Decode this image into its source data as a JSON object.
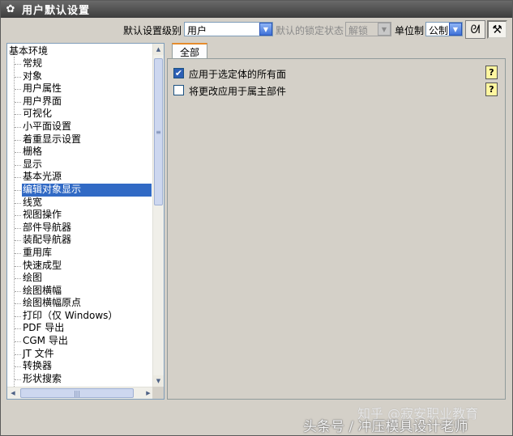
{
  "window": {
    "title": "用户默认设置",
    "icon": "gear-icon"
  },
  "toolbar": {
    "level_label": "默认设置级别",
    "level_value": "用户",
    "lock_label": "默认的锁定状态",
    "lock_value": "解锁",
    "unit_label": "单位制",
    "unit_value": "公制"
  },
  "tree": {
    "root": "基本环境",
    "items": [
      {
        "label": "常规"
      },
      {
        "label": "对象"
      },
      {
        "label": "用户属性"
      },
      {
        "label": "用户界面"
      },
      {
        "label": "可视化"
      },
      {
        "label": "小平面设置"
      },
      {
        "label": "着重显示设置"
      },
      {
        "label": "栅格"
      },
      {
        "label": "显示"
      },
      {
        "label": "基本光源"
      },
      {
        "label": "编辑对象显示"
      },
      {
        "label": "线宽"
      },
      {
        "label": "视图操作"
      },
      {
        "label": "部件导航器"
      },
      {
        "label": "装配导航器"
      },
      {
        "label": "重用库"
      },
      {
        "label": "快速成型"
      },
      {
        "label": "绘图"
      },
      {
        "label": "绘图横幅"
      },
      {
        "label": "绘图横幅原点"
      },
      {
        "label": "打印（仅 Windows）"
      },
      {
        "label": "PDF 导出"
      },
      {
        "label": "CGM 导出"
      },
      {
        "label": "JT 文件"
      },
      {
        "label": "转换器"
      },
      {
        "label": "形状搜索"
      }
    ],
    "selected_index": 10
  },
  "tabs": [
    {
      "label": "全部"
    }
  ],
  "options": [
    {
      "label": "应用于选定体的所有面",
      "checked": true
    },
    {
      "label": "将更改应用于属主部件",
      "checked": false
    }
  ],
  "watermark": {
    "line1": "知乎 @寂安职业教育",
    "line2": "头条号 / 冲压模具设计老师"
  }
}
